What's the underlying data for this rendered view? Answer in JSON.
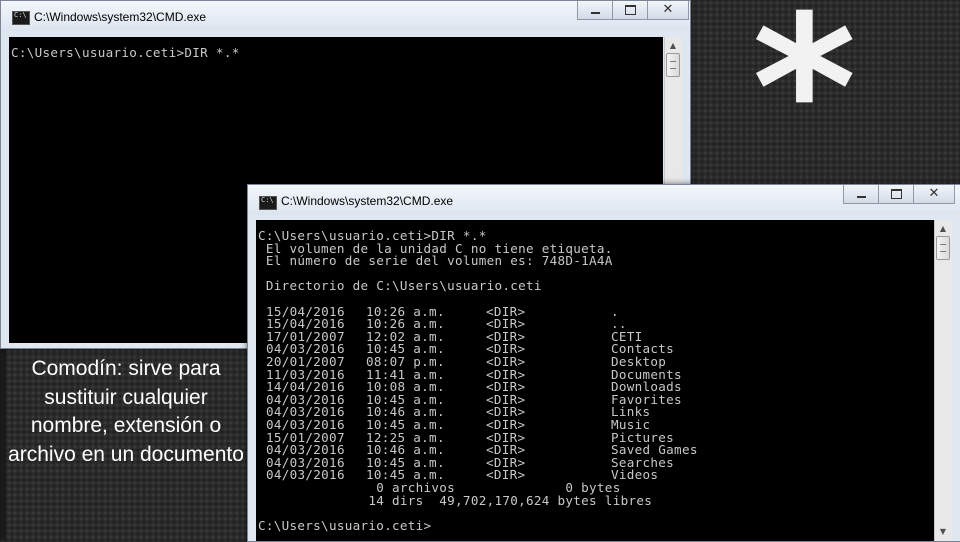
{
  "decoration": {
    "symbol": "*"
  },
  "caption": "Comodín: sirve para sustituir cualquier nombre, extensión o archivo en un documento",
  "window_back": {
    "title": "C:\\Windows\\system32\\CMD.exe",
    "prompt_line": "C:\\Users\\usuario.ceti>DIR *.*"
  },
  "window_front": {
    "title": "C:\\Windows\\system32\\CMD.exe",
    "lines": [
      "C:\\Users\\usuario.ceti>DIR *.*",
      " El volumen de la unidad C no tiene etiqueta.",
      " El número de serie del volumen es: 748D-1A4A",
      " Directorio de C:\\Users\\usuario.ceti"
    ],
    "listing": [
      {
        "date": "15/04/2016",
        "time": "10:26 a.m.",
        "type": "<DIR>",
        "name": "."
      },
      {
        "date": "15/04/2016",
        "time": "10:26 a.m.",
        "type": "<DIR>",
        "name": ".."
      },
      {
        "date": "17/01/2007",
        "time": "12:02 a.m.",
        "type": "<DIR>",
        "name": "CETI"
      },
      {
        "date": "04/03/2016",
        "time": "10:45 a.m.",
        "type": "<DIR>",
        "name": "Contacts"
      },
      {
        "date": "20/01/2007",
        "time": "08:07 p.m.",
        "type": "<DIR>",
        "name": "Desktop"
      },
      {
        "date": "11/03/2016",
        "time": "11:41 a.m.",
        "type": "<DIR>",
        "name": "Documents"
      },
      {
        "date": "14/04/2016",
        "time": "10:08 a.m.",
        "type": "<DIR>",
        "name": "Downloads"
      },
      {
        "date": "04/03/2016",
        "time": "10:45 a.m.",
        "type": "<DIR>",
        "name": "Favorites"
      },
      {
        "date": "04/03/2016",
        "time": "10:46 a.m.",
        "type": "<DIR>",
        "name": "Links"
      },
      {
        "date": "04/03/2016",
        "time": "10:45 a.m.",
        "type": "<DIR>",
        "name": "Music"
      },
      {
        "date": "15/01/2007",
        "time": "12:25 a.m.",
        "type": "<DIR>",
        "name": "Pictures"
      },
      {
        "date": "04/03/2016",
        "time": "10:46 a.m.",
        "type": "<DIR>",
        "name": "Saved Games"
      },
      {
        "date": "04/03/2016",
        "time": "10:45 a.m.",
        "type": "<DIR>",
        "name": "Searches"
      },
      {
        "date": "04/03/2016",
        "time": "10:45 a.m.",
        "type": "<DIR>",
        "name": "Videos"
      }
    ],
    "summary_files": "               0 archivos              0 bytes",
    "summary_dirs": "              14 dirs  49,702,170,624 bytes libres",
    "final_prompt": "C:\\Users\\usuario.ceti>"
  },
  "controls": {
    "close": "✕"
  },
  "colors": {
    "console_bg": "#000000",
    "console_text": "#c8c8c8",
    "titlebar": "#dbe4ef"
  }
}
